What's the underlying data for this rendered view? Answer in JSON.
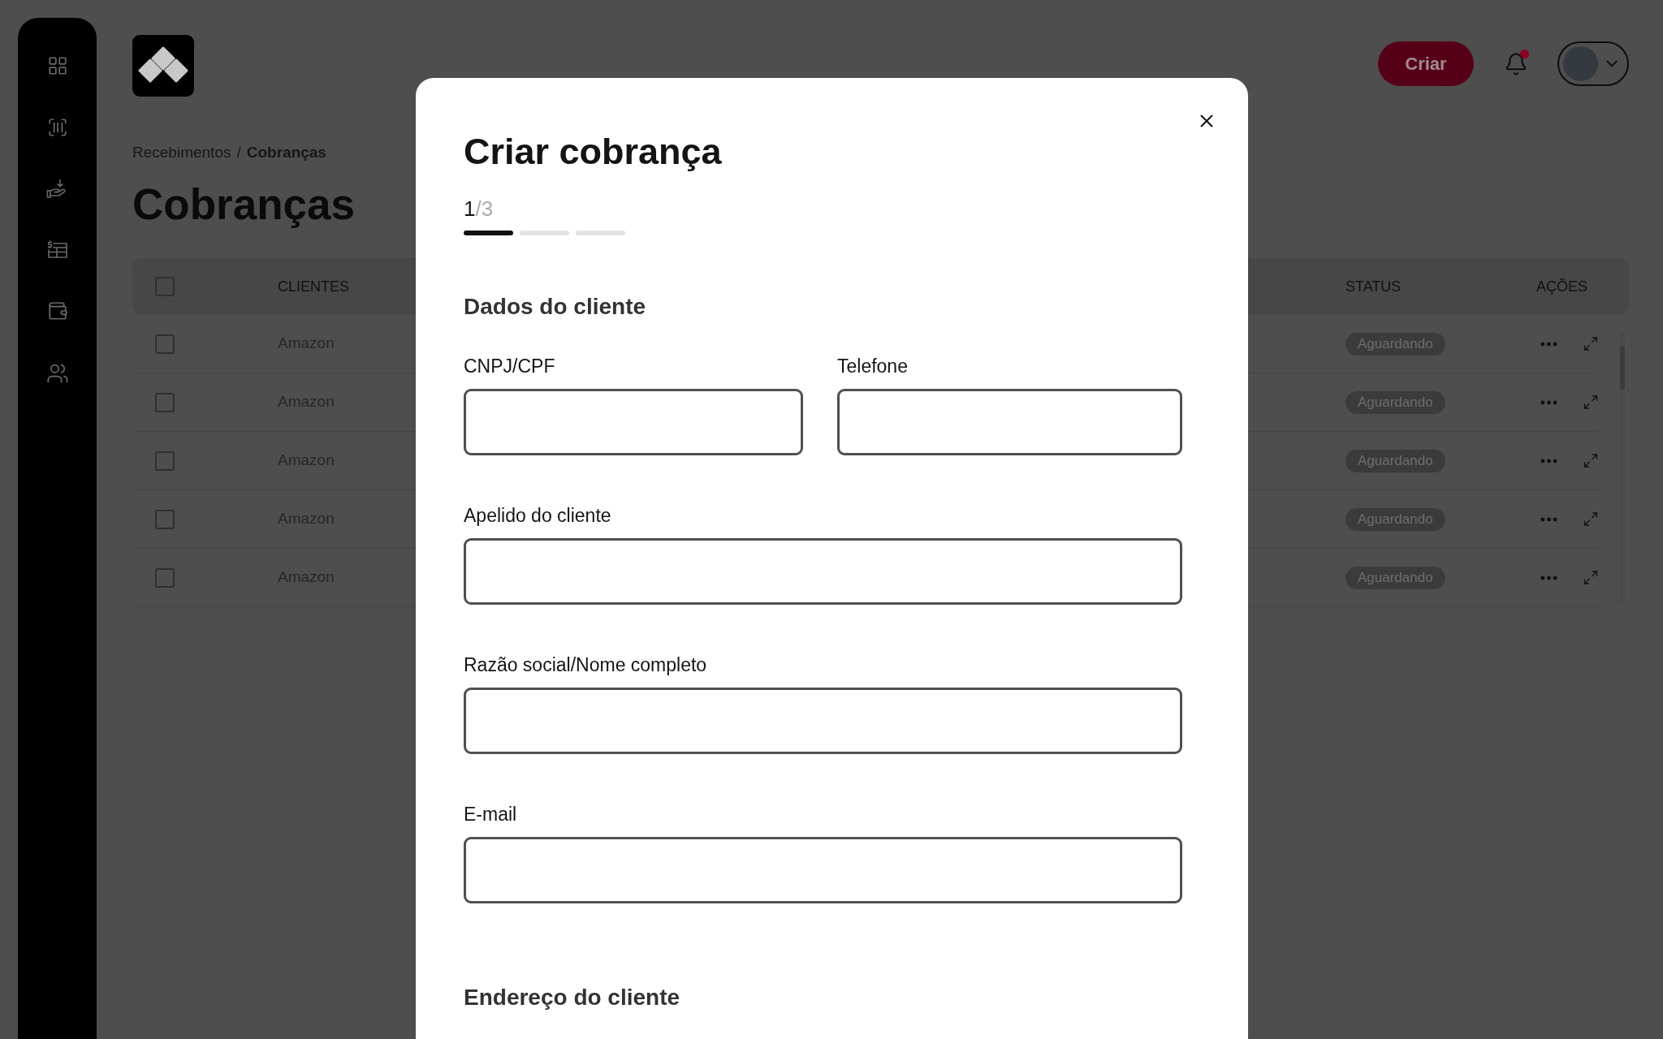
{
  "top_bar": {
    "create_button": "Criar",
    "notifications": {
      "unread": true
    }
  },
  "breadcrumb": {
    "separator": "/",
    "items": [
      {
        "label": "Recebimentos",
        "current": false
      },
      {
        "label": "Cobranças",
        "current": true
      }
    ]
  },
  "page_title": "Cobranças",
  "table": {
    "select_all": {
      "checked": false
    },
    "columns": [
      "CLIENTES",
      "STATUS",
      "AÇÕES"
    ],
    "rows": [
      {
        "checked": false,
        "client": "Amazon",
        "status": "Aguardando"
      },
      {
        "checked": false,
        "client": "Amazon",
        "status": "Aguardando"
      },
      {
        "checked": false,
        "client": "Amazon",
        "status": "Aguardando"
      },
      {
        "checked": false,
        "client": "Amazon",
        "status": "Aguardando"
      },
      {
        "checked": false,
        "client": "Amazon",
        "status": "Aguardando"
      }
    ]
  },
  "modal": {
    "title": "Criar cobrança",
    "step": {
      "current": "1",
      "total": "/3"
    },
    "progress": [
      {
        "done": true
      },
      {
        "done": false
      },
      {
        "done": false
      }
    ],
    "sections": [
      {
        "title": "Dados do cliente",
        "field_rows": [
          {
            "fields": [
              {
                "label": "CNPJ/CPF"
              },
              {
                "label": "Telefone"
              }
            ]
          },
          {
            "fields": [
              {
                "label": "Apelido do cliente"
              }
            ]
          },
          {
            "fields": [
              {
                "label": "Razão social/Nome completo"
              }
            ]
          },
          {
            "fields": [
              {
                "label": "E-mail"
              }
            ]
          }
        ]
      },
      {
        "title": "Endereço do cliente"
      }
    ]
  }
}
